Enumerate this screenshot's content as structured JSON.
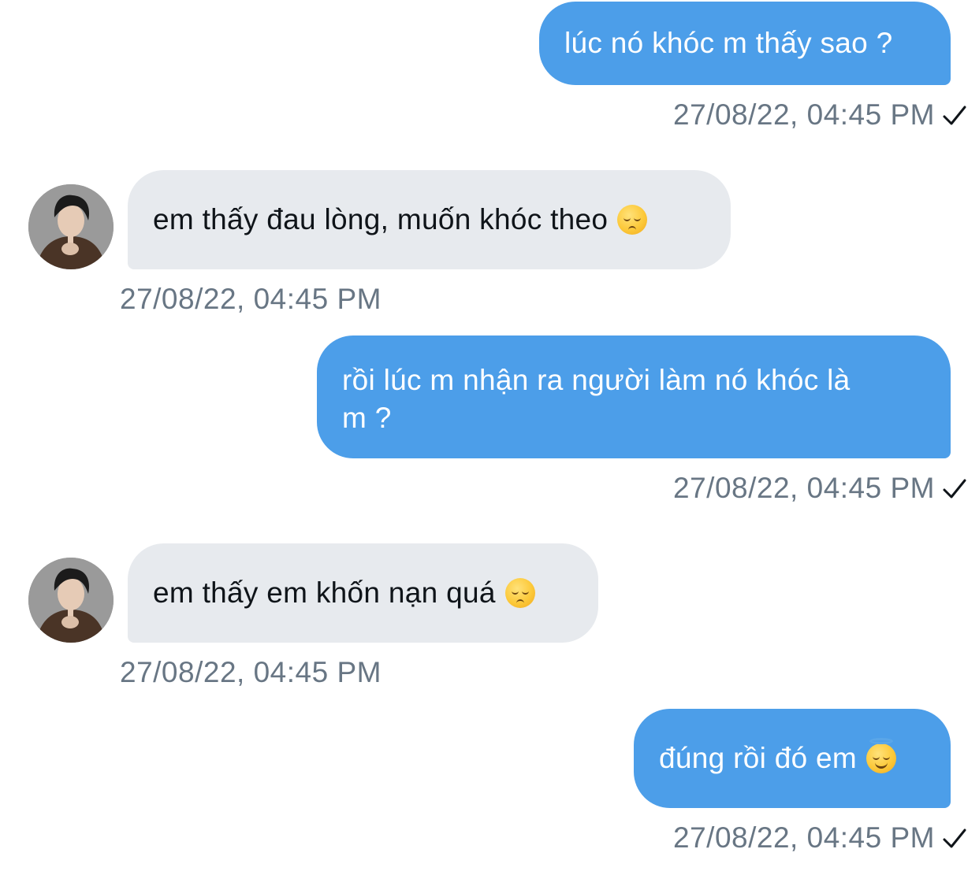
{
  "messages": [
    {
      "side": "sent",
      "text": "lúc nó khóc m thấy sao ?",
      "timestamp": "27/08/22, 04:45 PM",
      "read_receipt": "check-icon"
    },
    {
      "side": "received",
      "text": "em thấy đau lòng, muốn khóc theo",
      "emoji": "pensive-face-emoji",
      "timestamp": "27/08/22, 04:45 PM"
    },
    {
      "side": "sent",
      "line1": "rồi lúc m nhận ra người làm nó khóc là",
      "line2": "m ?",
      "timestamp": "27/08/22, 04:45 PM",
      "read_receipt": "check-icon"
    },
    {
      "side": "received",
      "text": "em thấy em khốn nạn quá",
      "emoji": "pensive-face-emoji",
      "timestamp": "27/08/22, 04:45 PM"
    },
    {
      "side": "sent",
      "text": "đúng rồi đó em",
      "emoji": "smiling-face-with-halo-emoji",
      "timestamp": "27/08/22, 04:45 PM",
      "read_receipt": "check-icon"
    }
  ],
  "colors": {
    "sent_bubble": "#4c9ee9",
    "received_bubble": "#e7eaee",
    "timestamp": "#687684"
  }
}
